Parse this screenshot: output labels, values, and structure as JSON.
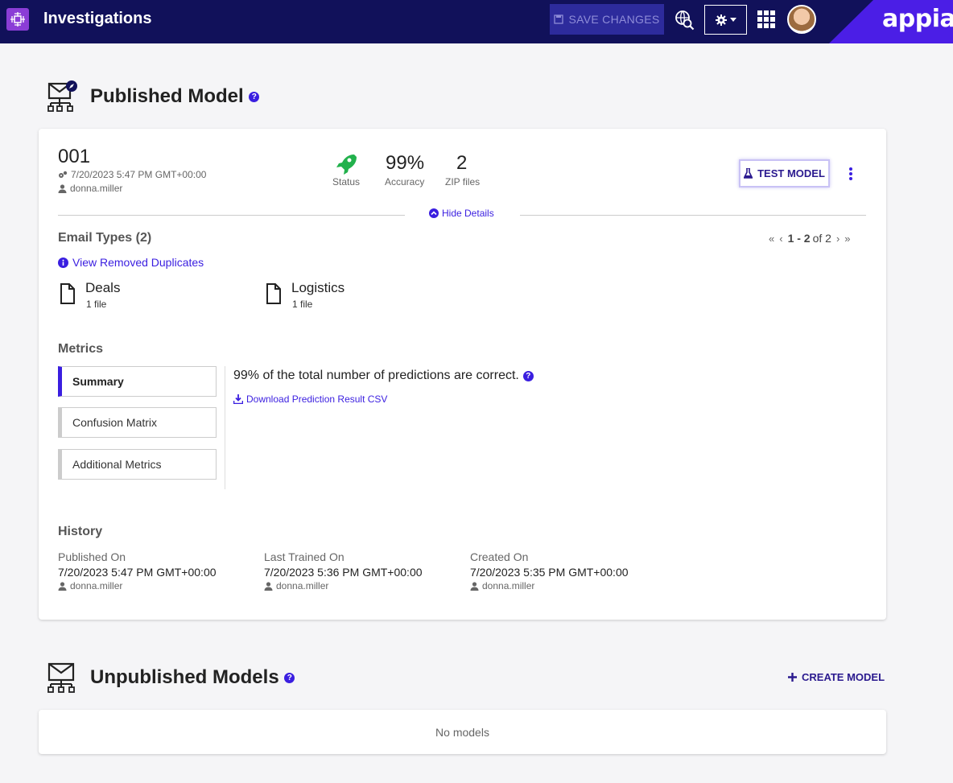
{
  "header": {
    "title": "Investigations",
    "save_label": "SAVE CHANGES",
    "brand": "appian"
  },
  "published": {
    "title": "Published Model",
    "model_id": "001",
    "timestamp": "7/20/2023 5:47 PM GMT+00:00",
    "user": "donna.miller",
    "stats": {
      "status_label": "Status",
      "accuracy_value": "99%",
      "accuracy_label": "Accuracy",
      "zip_value": "2",
      "zip_label": "ZIP files"
    },
    "test_label": "TEST MODEL",
    "hide_details": "Hide Details",
    "email_types_title": "Email Types (2)",
    "view_removed": "View Removed Duplicates",
    "pager": {
      "range": "1 - 2",
      "of": "of 2"
    },
    "email_types": [
      {
        "name": "Deals",
        "count": "1 file"
      },
      {
        "name": "Logistics",
        "count": "1 file"
      }
    ],
    "metrics_title": "Metrics",
    "metric_tabs": [
      "Summary",
      "Confusion Matrix",
      "Additional Metrics"
    ],
    "summary_text": "99% of the total number of predictions are correct.",
    "download_label": "Download Prediction Result CSV",
    "history_title": "History",
    "history": [
      {
        "label": "Published On",
        "date": "7/20/2023 5:47 PM GMT+00:00",
        "user": "donna.miller"
      },
      {
        "label": "Last Trained On",
        "date": "7/20/2023 5:36 PM GMT+00:00",
        "user": "donna.miller"
      },
      {
        "label": "Created On",
        "date": "7/20/2023 5:35 PM GMT+00:00",
        "user": "donna.miller"
      }
    ]
  },
  "unpublished": {
    "title": "Unpublished Models",
    "create_label": "CREATE MODEL",
    "empty_text": "No models"
  },
  "colors": {
    "topbar": "#11115a",
    "accent": "#3a1ee0",
    "brand": "#4b1ee6",
    "status_green": "#22b14c"
  },
  "icons": [
    "app-grid-icon",
    "save-icon",
    "globe-search-icon",
    "gear-icon",
    "apps-grid-icon",
    "model-icon",
    "rocket-icon",
    "flask-icon",
    "file-icon",
    "info-icon",
    "download-icon",
    "user-icon",
    "plus-icon"
  ]
}
